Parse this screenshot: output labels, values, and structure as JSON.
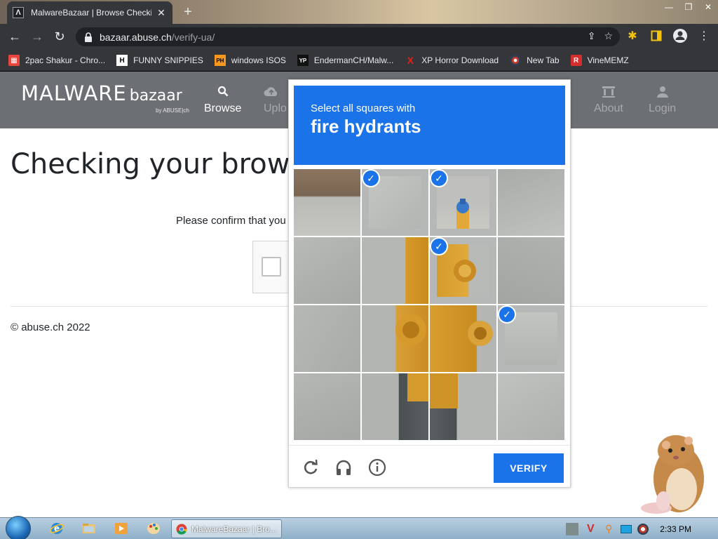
{
  "browser": {
    "tab_title": "MalwareBazaar | Browse Checkin",
    "tab_favicon": "Λ",
    "url_host": "bazaar.abuse.ch",
    "url_path": "/verify-ua/"
  },
  "bookmarks": [
    {
      "label": "2pac Shakur - Chro...",
      "icon": "Ⓟ",
      "color": "#e8453c"
    },
    {
      "label": "FUNNY SNIPPIES",
      "icon": "H",
      "color": "#ffffff"
    },
    {
      "label": "windows ISOS",
      "icon": "PH",
      "color": "#f7971d"
    },
    {
      "label": "EndermanCH/Malw...",
      "icon": "YP",
      "color": "#ffffff"
    },
    {
      "label": "XP Horror Download",
      "icon": "X",
      "color": "#e0231a"
    },
    {
      "label": "New Tab",
      "icon": "◉",
      "color": "#9aa0a6"
    },
    {
      "label": "VineMEMZ",
      "icon": "R",
      "color": "#d62d2d"
    }
  ],
  "site": {
    "logo_main": "MALWARE",
    "logo_sub": "bazaar",
    "logo_by": "by ABUSE|ch",
    "nav": {
      "browse": "Browse",
      "upload": "Uplo",
      "about": "About",
      "login": "Login"
    },
    "page_title": "Checking your browse",
    "confirm_text": "Please confirm that you",
    "footer": "© abuse.ch 2022"
  },
  "captcha": {
    "instruction": "Select all squares with",
    "target": "fire hydrants",
    "verify_label": "VERIFY",
    "selected_tiles": [
      1,
      2,
      6,
      11
    ],
    "accent": "#1a73e8"
  },
  "taskbar": {
    "task_label": "MalwareBazaar | Bro...",
    "clock": "2:33 PM"
  }
}
